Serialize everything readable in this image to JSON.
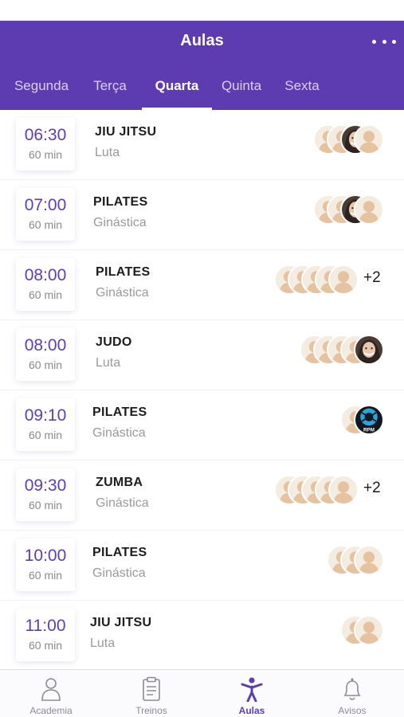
{
  "header": {
    "title": "Aulas",
    "more_icon": "more-horizontal-icon",
    "background": "#5d3bb0"
  },
  "tabs": [
    {
      "label": "Segunda",
      "active": false
    },
    {
      "label": "Terça",
      "active": false
    },
    {
      "label": "Quarta",
      "active": true
    },
    {
      "label": "Quinta",
      "active": false
    },
    {
      "label": "Sexta",
      "active": false
    }
  ],
  "classes": [
    {
      "time": "06:30",
      "duration": "60 min",
      "name": "JIU JITSU",
      "type": "Luta",
      "avatars": [
        "placeholder",
        "placeholder",
        "photo-woman",
        "placeholder"
      ],
      "extra": ""
    },
    {
      "time": "07:00",
      "duration": "60 min",
      "name": "PILATES",
      "type": "Ginástica",
      "avatars": [
        "placeholder",
        "placeholder",
        "photo-woman",
        "placeholder"
      ],
      "extra": ""
    },
    {
      "time": "08:00",
      "duration": "60 min",
      "name": "PILATES",
      "type": "Ginástica",
      "avatars": [
        "placeholder",
        "placeholder",
        "placeholder",
        "placeholder",
        "placeholder"
      ],
      "extra": "+2"
    },
    {
      "time": "08:00",
      "duration": "60 min",
      "name": "JUDO",
      "type": "Luta",
      "avatars": [
        "placeholder",
        "placeholder",
        "placeholder",
        "placeholder",
        "photo-woman"
      ],
      "extra": ""
    },
    {
      "time": "09:10",
      "duration": "60 min",
      "name": "PILATES",
      "type": "Ginástica",
      "avatars": [
        "placeholder",
        "rpm-logo"
      ],
      "extra": ""
    },
    {
      "time": "09:30",
      "duration": "60 min",
      "name": "ZUMBA",
      "type": "Ginástica",
      "avatars": [
        "placeholder",
        "placeholder",
        "placeholder",
        "placeholder",
        "placeholder"
      ],
      "extra": "+2"
    },
    {
      "time": "10:00",
      "duration": "60 min",
      "name": "PILATES",
      "type": "Ginástica",
      "avatars": [
        "placeholder",
        "placeholder",
        "placeholder"
      ],
      "extra": ""
    },
    {
      "time": "11:00",
      "duration": "60 min",
      "name": "JIU JITSU",
      "type": "Luta",
      "avatars": [
        "placeholder",
        "placeholder"
      ],
      "extra": ""
    }
  ],
  "tabbar": [
    {
      "label": "Academia",
      "icon": "person-outline-icon",
      "active": false
    },
    {
      "label": "Treinos",
      "icon": "clipboard-icon",
      "active": false
    },
    {
      "label": "Aulas",
      "icon": "person-arms-up-icon",
      "active": true
    },
    {
      "label": "Avisos",
      "icon": "bell-icon",
      "active": false
    }
  ],
  "avatar_logo_text": "RPM",
  "colors": {
    "accent": "#5b3fb2",
    "placeholder_face": "#e9c8a8"
  }
}
